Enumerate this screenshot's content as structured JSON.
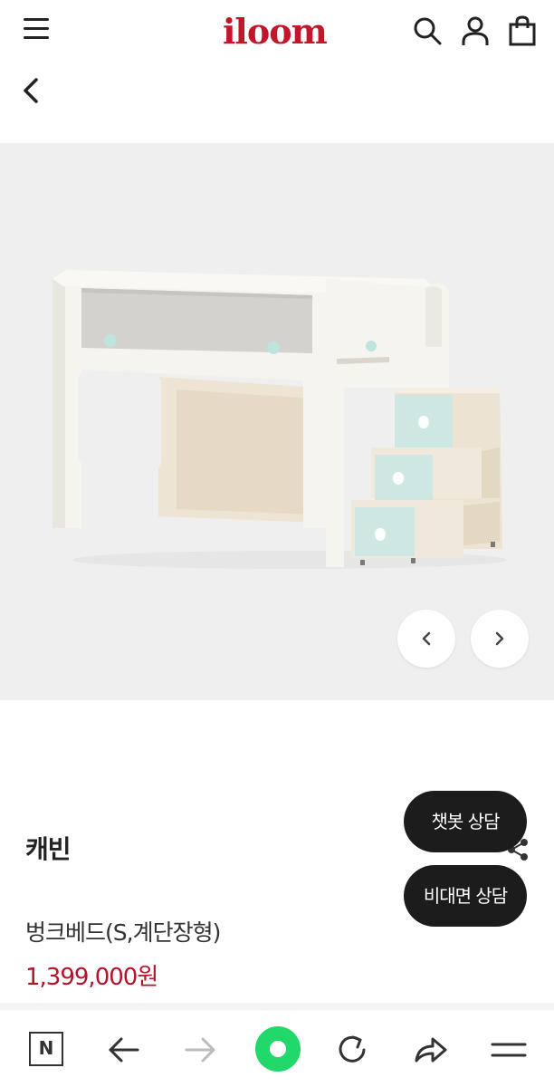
{
  "header": {
    "logo": "iloom",
    "icons": [
      "menu-icon",
      "search-icon",
      "user-icon",
      "shopping-bag-icon"
    ]
  },
  "navigation": {
    "back_icon": "chevron-left-icon"
  },
  "gallery": {
    "prev_icon": "chevron-left-icon",
    "next_icon": "chevron-right-icon"
  },
  "product": {
    "name": "캐빈",
    "category": "벙크베드(S,계단장형)",
    "price": "1,399,000원"
  },
  "floating_buttons": {
    "chatbot": "챗봇 상담",
    "contactless": "비대면 상담"
  },
  "browser_toolbar": {
    "n_label": "N",
    "icons": [
      "naver-icon",
      "back-arrow-icon",
      "forward-arrow-icon",
      "home-icon",
      "refresh-icon",
      "share-icon",
      "menu-icon"
    ]
  },
  "colors": {
    "brand": "#c3162a",
    "price": "#b5132a",
    "floating_button": "#1c1c1c",
    "home_button": "#20d96a"
  }
}
